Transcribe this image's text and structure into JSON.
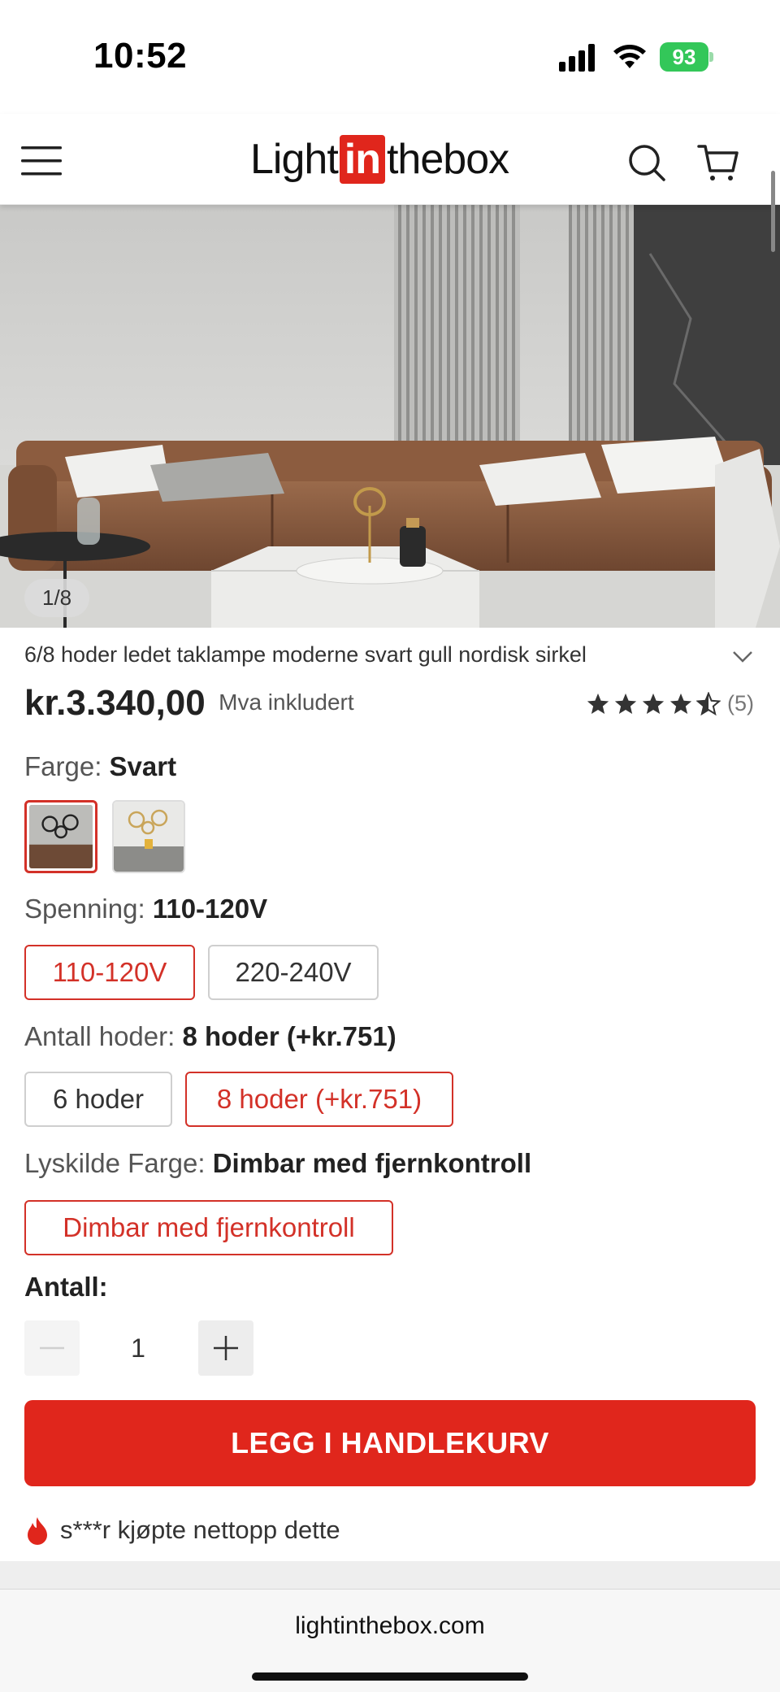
{
  "status_bar": {
    "time": "10:52",
    "battery": "93"
  },
  "header": {
    "logo_light": "Light",
    "logo_in": "in",
    "logo_thebox": "thebox"
  },
  "gallery": {
    "counter": "1/8"
  },
  "product": {
    "title": "6/8 hoder ledet taklampe moderne svart gull nordisk sirkel",
    "price": "kr.3.340,00",
    "vat_note": "Mva inkludert",
    "rating": 4.5,
    "review_count": "(5)"
  },
  "options": {
    "color": {
      "label": "Farge:",
      "selected": "Svart"
    },
    "voltage": {
      "label": "Spenning:",
      "selected": "110-120V",
      "choices": [
        "110-120V",
        "220-240V"
      ]
    },
    "heads": {
      "label": "Antall hoder:",
      "selected": "8 hoder (+kr.751)",
      "choices": [
        "6 hoder",
        "8 hoder (+kr.751)"
      ]
    },
    "light_color": {
      "label": "Lyskilde Farge:",
      "selected": "Dimbar med fjernkontroll",
      "choices": [
        "Dimbar med fjernkontroll"
      ]
    }
  },
  "quantity": {
    "label": "Antall:",
    "value": "1"
  },
  "cta": {
    "add_to_cart": "LEGG I HANDLEKURV"
  },
  "social_proof": {
    "text": "s***r kjøpte nettopp dette"
  },
  "browser": {
    "url": "lightinthebox.com"
  },
  "colors": {
    "accent": "#e0261c",
    "selected_border": "#d33128"
  }
}
